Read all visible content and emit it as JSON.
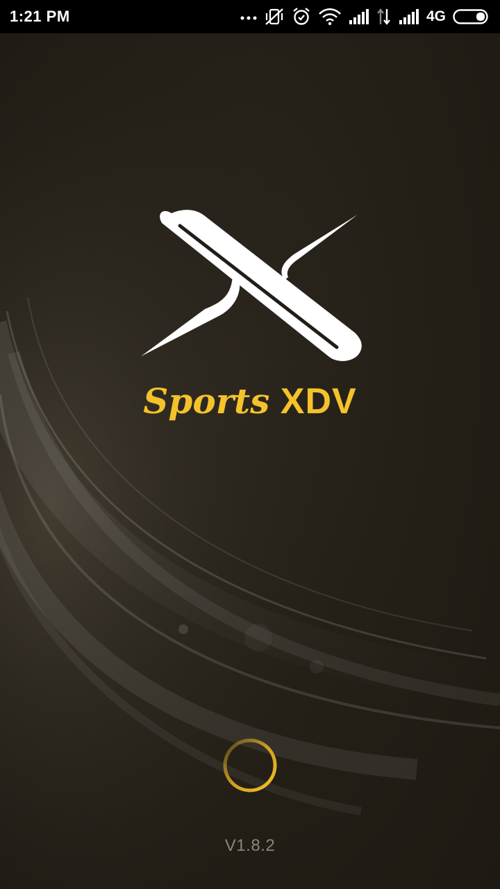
{
  "status_bar": {
    "time": "1:21 PM",
    "network_type": "4G",
    "icons": [
      "more-dots-icon",
      "vibrate-off-icon",
      "alarm-icon",
      "wifi-icon",
      "signal-icon",
      "data-transfer-icon",
      "signal-icon-2",
      "battery-icon"
    ]
  },
  "splash": {
    "brand_prefix": "Sports",
    "brand_suffix": "XDV",
    "version": "V1.8.2",
    "logo_icon": "x-logo-icon",
    "loader_icon": "loading-spinner-icon"
  },
  "colors": {
    "background": "#221e17",
    "brand_yellow": "#f4c22b",
    "logo_white": "#ffffff",
    "version_gray": "#8a8680"
  }
}
